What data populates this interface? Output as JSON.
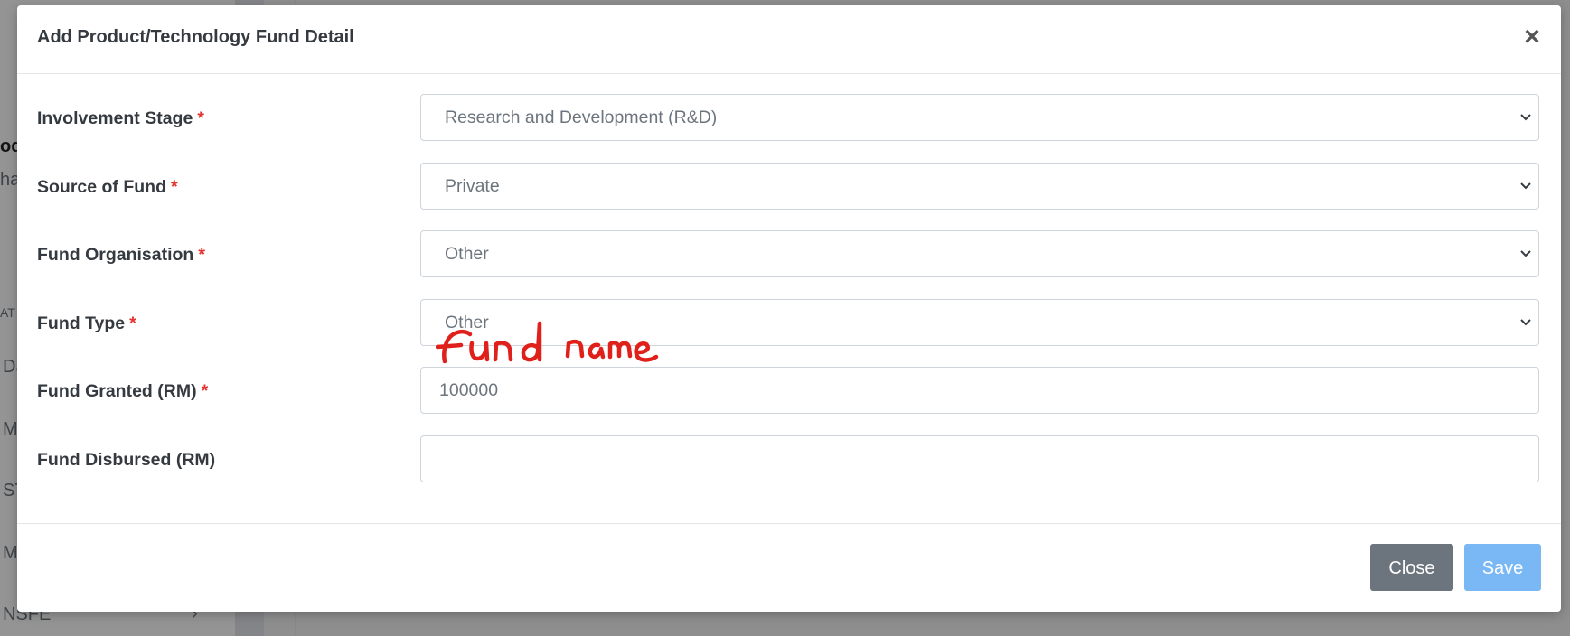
{
  "background": {
    "sidebar_items": [
      "od",
      "ha",
      "AT",
      "Da",
      "M",
      "ST",
      "M",
      "NSFE"
    ]
  },
  "modal": {
    "title": "Add Product/Technology Fund Detail",
    "close_symbol": "×",
    "fields": [
      {
        "label": "Involvement Stage",
        "required": true,
        "type": "select",
        "value": "Research and Development (R&D)"
      },
      {
        "label": "Source of Fund",
        "required": true,
        "type": "select",
        "value": "Private"
      },
      {
        "label": "Fund Organisation",
        "required": true,
        "type": "select",
        "value": "Other"
      },
      {
        "label": "Fund Type",
        "required": true,
        "type": "select",
        "value": "Other"
      },
      {
        "label": "Fund Granted (RM)",
        "required": true,
        "type": "input",
        "value": "100000"
      },
      {
        "label": "Fund Disbursed (RM)",
        "required": false,
        "type": "input",
        "value": ""
      }
    ],
    "required_marker": "*",
    "footer": {
      "close_label": "Close",
      "save_label": "Save"
    }
  },
  "annotation": {
    "text": "fund name",
    "color": "#e0201b"
  },
  "colors": {
    "required": "#e3342f",
    "close_button": "#6c757d",
    "save_button": "#7ab8f5"
  }
}
